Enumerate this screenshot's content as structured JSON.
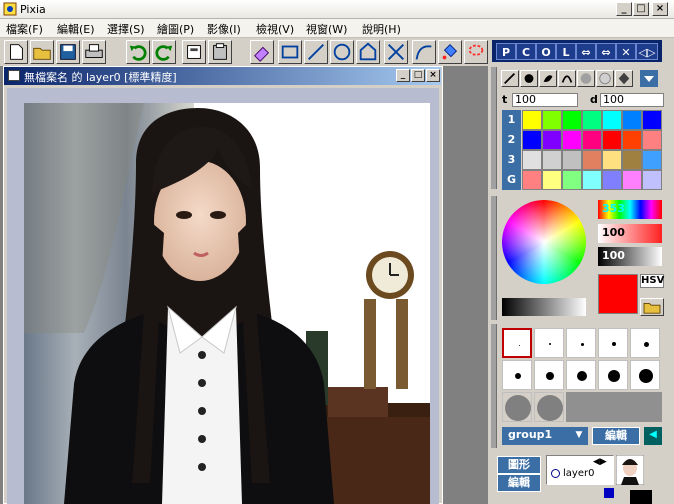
{
  "app": {
    "title": "Pixia"
  },
  "window_controls": {
    "minimize": "_",
    "maximize": "□",
    "close": "×"
  },
  "menu": [
    "檔案(F)",
    "編輯(E)",
    "選擇(S)",
    "繪圖(P)",
    "影像(I)",
    "檢視(V)",
    "視窗(W)",
    "說明(H)"
  ],
  "pcol": [
    "P",
    "C",
    "O",
    "L"
  ],
  "pcol_extra": [
    "⇔",
    "⇔",
    "✕",
    "◁▷"
  ],
  "document": {
    "title": "無檔案名 的 layer0 [標準精度]"
  },
  "brush": {
    "size_label": "t",
    "size": "100",
    "density_label": "d",
    "density": "100"
  },
  "palette": {
    "row_labels": [
      "1",
      "2",
      "3",
      "G"
    ],
    "rows": [
      [
        "#ffff00",
        "#80ff00",
        "#00ff00",
        "#00ff80",
        "#00ffff",
        "#0080ff",
        "#0000ff"
      ],
      [
        "#0000ff",
        "#8000ff",
        "#ff00ff",
        "#ff0080",
        "#ff0000",
        "#ff4000",
        "#ff8080"
      ],
      [
        "#e0e0e0",
        "#d0d0d0",
        "#c0c0c0",
        "#e08060",
        "#ffe080",
        "#a08040",
        "#40a0ff"
      ],
      [
        "#ff8080",
        "#ffff80",
        "#80ff80",
        "#80ffff",
        "#8080ff",
        "#ff80ff",
        "#c0c0ff"
      ]
    ]
  },
  "color": {
    "h": "353",
    "s": "100",
    "v": "100",
    "mode": "HSV",
    "current": "#ff0000"
  },
  "layers": {
    "group": "group1",
    "edit_label": "編輯",
    "figure_label": "圖形",
    "edit_label2": "編輯",
    "layer_name": "layer0"
  },
  "icons": [
    "app-icon",
    "new-icon",
    "open-icon",
    "save-icon",
    "print-icon",
    "undo-icon",
    "redo-icon",
    "copy-icon",
    "paste-icon",
    "eraser-icon",
    "rectangle-icon",
    "line-icon",
    "circle-icon",
    "polygon-icon",
    "cross-icon",
    "curve-icon",
    "bucket-icon",
    "lasso-icon"
  ]
}
